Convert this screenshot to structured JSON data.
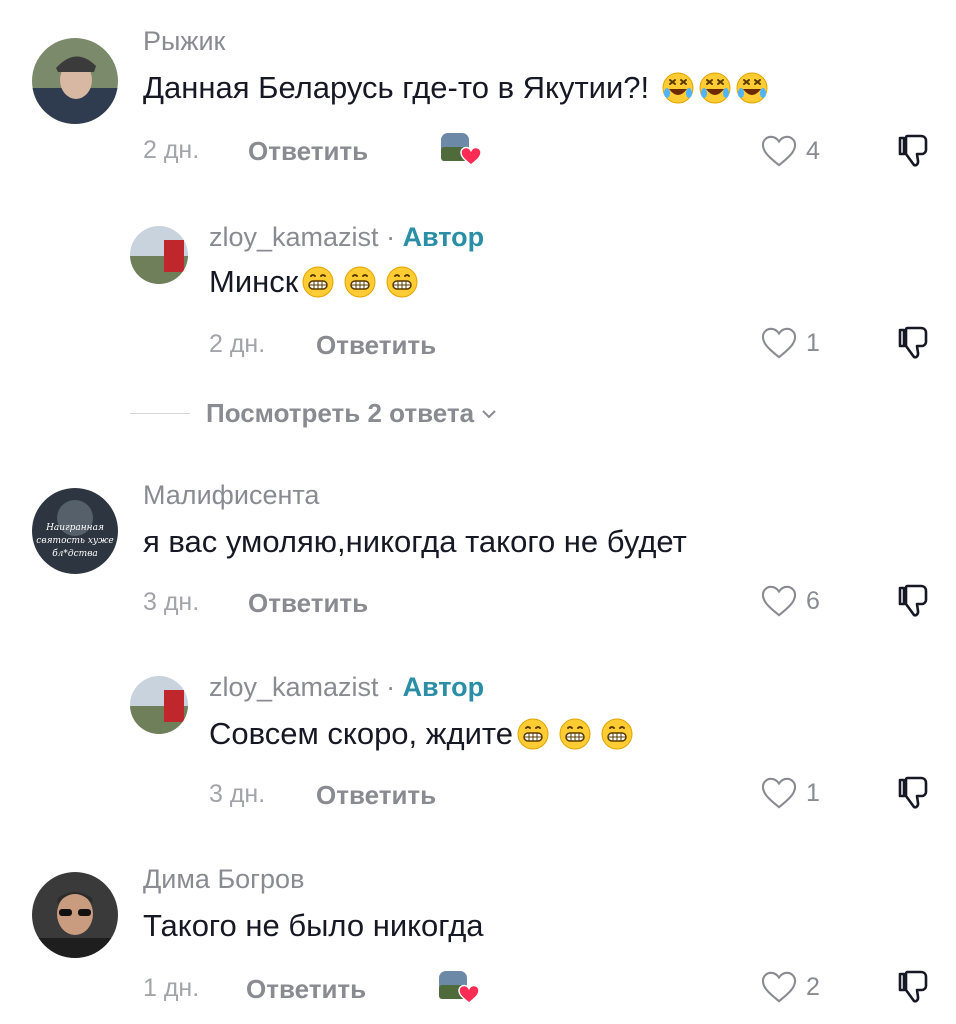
{
  "comments": [
    {
      "username": "Рыжик",
      "text": "Данная Беларусь где-то в Якутии?!",
      "emoji": [
        "rolling-on-floor-laughing",
        "rolling-on-floor-laughing",
        "rolling-on-floor-laughing"
      ],
      "time": "2 дн.",
      "reply_label": "Ответить",
      "likes": "4",
      "creator_liked": true
    },
    {
      "username": "zloy_kamazist",
      "author_sep": " · ",
      "author_tag": "Автор",
      "text": "Минск",
      "emoji": [
        "grinning-face",
        "grinning-face",
        "grinning-face"
      ],
      "time": "2 дн.",
      "reply_label": "Ответить",
      "likes": "1"
    },
    {
      "username": "Малифисента",
      "text": "я вас умоляю,никогда такого не будет",
      "time": "3 дн.",
      "reply_label": "Ответить",
      "likes": "6",
      "avatar_text": [
        "Наигранная",
        "святость хуже",
        "бл*дства"
      ]
    },
    {
      "username": "zloy_kamazist",
      "author_sep": " · ",
      "author_tag": "Автор",
      "text": "Совсем скоро, ждите",
      "emoji": [
        "grinning-face",
        "grinning-face",
        "grinning-face"
      ],
      "time": "3 дн.",
      "reply_label": "Ответить",
      "likes": "1"
    },
    {
      "username": "Дима Богров",
      "text": "Такого не было никогда",
      "time": "1 дн.",
      "reply_label": "Ответить",
      "likes": "2",
      "creator_liked": true
    }
  ],
  "view_replies": "Посмотреть 2 ответа",
  "icons": {
    "like": "heart-outline-icon",
    "dislike": "thumbs-down-icon",
    "creator_liked": "creator-liked-heart-icon",
    "expand": "chevron-down-icon"
  },
  "colors": {
    "author_tag": "#2a8fa6",
    "liked_heart": "#fe2c55",
    "secondary_text": "#8a8b91"
  }
}
